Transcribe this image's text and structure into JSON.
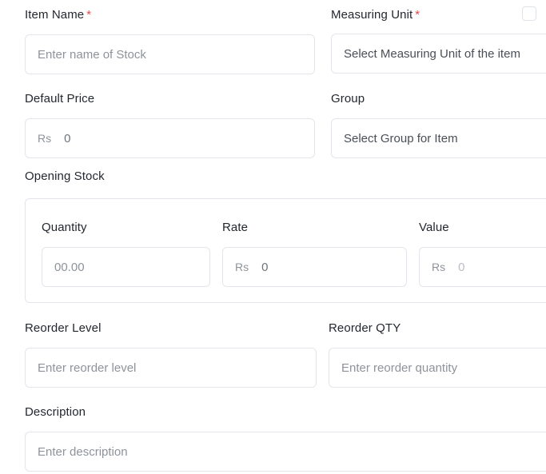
{
  "item_name": {
    "label": "Item Name",
    "required_mark": "*",
    "placeholder": "Enter name of Stock"
  },
  "measuring_unit": {
    "label": "Measuring Unit",
    "required_mark": "*",
    "placeholder": "Select Measuring Unit of the item"
  },
  "default_price": {
    "label": "Default Price",
    "currency": "Rs",
    "value": "0"
  },
  "group": {
    "label": "Group",
    "placeholder": "Select Group for Item"
  },
  "opening_stock": {
    "label": "Opening Stock",
    "quantity": {
      "label": "Quantity",
      "placeholder": "00.00"
    },
    "rate": {
      "label": "Rate",
      "currency": "Rs",
      "value": "0"
    },
    "value": {
      "label": "Value",
      "currency": "Rs",
      "value": "0"
    }
  },
  "reorder_level": {
    "label": "Reorder Level",
    "placeholder": "Enter reorder level"
  },
  "reorder_qty": {
    "label": "Reorder QTY",
    "placeholder": "Enter reorder quantity"
  },
  "description": {
    "label": "Description",
    "placeholder": "Enter description"
  },
  "colors": {
    "required": "#e5484d",
    "border": "#e3e5ea",
    "placeholder": "#8e939b",
    "label": "#23272e"
  }
}
